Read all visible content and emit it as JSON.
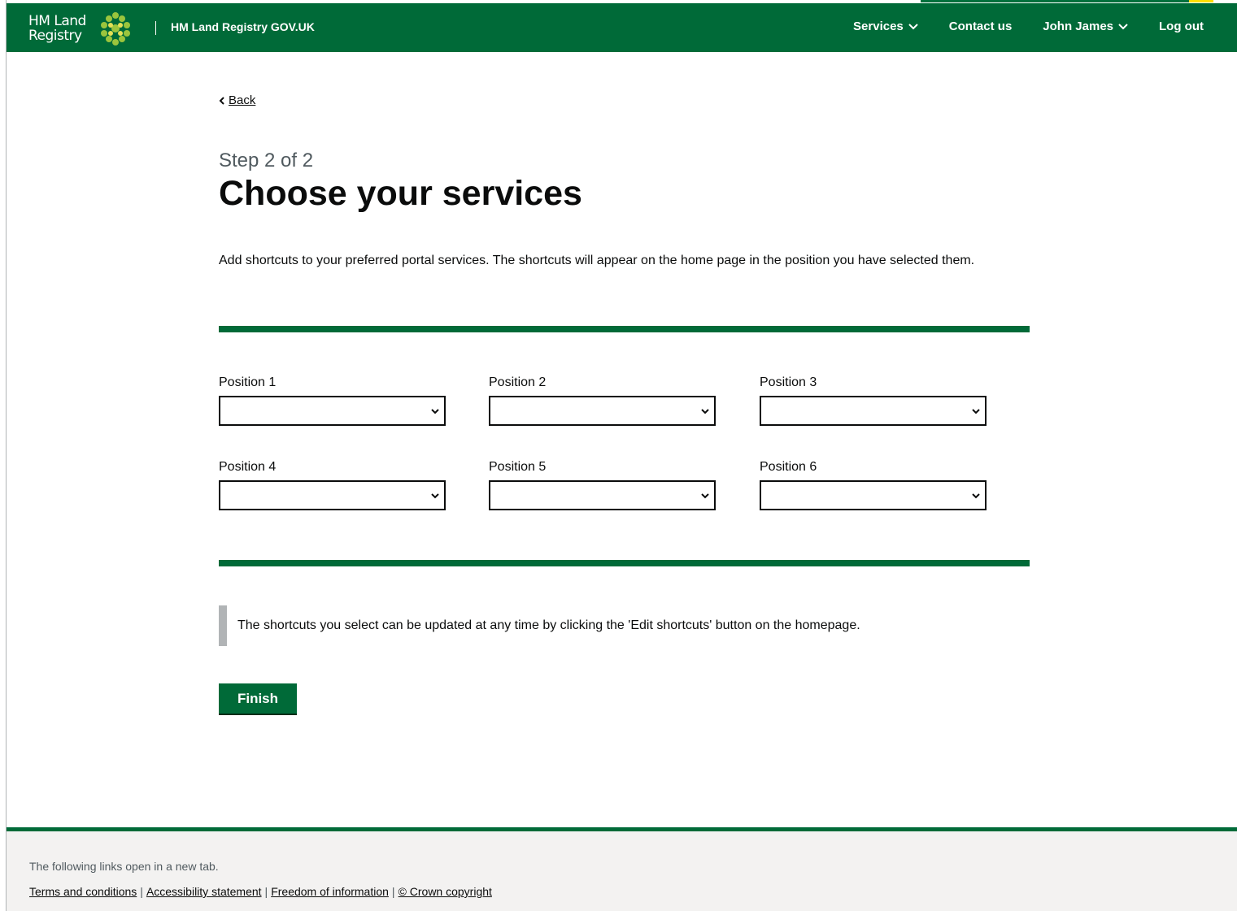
{
  "header": {
    "logo_line1": "HM Land",
    "logo_line2": "Registry",
    "site_title": "HM Land Registry GOV.UK",
    "nav": {
      "services": "Services",
      "contact": "Contact us",
      "user": "John James",
      "logout": "Log out"
    }
  },
  "back_label": "Back",
  "caption": "Step 2 of 2",
  "title": "Choose your services",
  "intro": "Add shortcuts to your preferred portal services. The shortcuts will appear on the home page in the position you have selected them.",
  "positions": [
    {
      "label": "Position 1",
      "value": ""
    },
    {
      "label": "Position 2",
      "value": ""
    },
    {
      "label": "Position 3",
      "value": ""
    },
    {
      "label": "Position 4",
      "value": ""
    },
    {
      "label": "Position 5",
      "value": ""
    },
    {
      "label": "Position 6",
      "value": ""
    }
  ],
  "inset_text": "The shortcuts you select can be updated at any time by clicking the 'Edit shortcuts' button on the homepage.",
  "finish_label": "Finish",
  "footer": {
    "note": "The following links open in a new tab.",
    "links": [
      "Terms and conditions",
      "Accessibility statement",
      "Freedom of information",
      "© Crown copyright"
    ]
  },
  "colors": {
    "brand_green": "#006a38",
    "inset_border": "#b1b4b6",
    "footer_bg": "#f3f2f1"
  }
}
